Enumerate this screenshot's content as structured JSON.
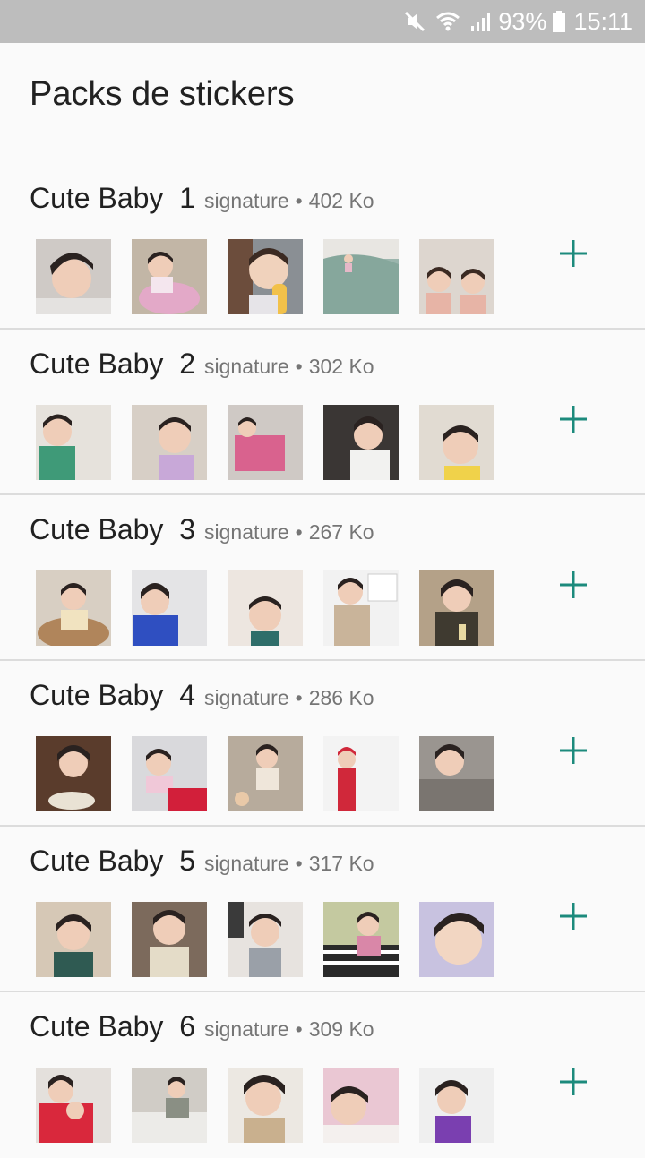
{
  "status_bar": {
    "battery": "93%",
    "time": "15:11",
    "icons": [
      "mute-icon",
      "wifi-icon",
      "signal-icon",
      "battery-icon"
    ],
    "color": "#bdbdbd"
  },
  "page": {
    "title": "Packs de stickers"
  },
  "accent_color": "#1c8a7c",
  "packs": [
    {
      "name": "Cute Baby  1",
      "author": "signature",
      "separator": "•",
      "size": "402 Ko"
    },
    {
      "name": "Cute Baby  2",
      "author": "signature",
      "separator": "•",
      "size": "302 Ko"
    },
    {
      "name": "Cute Baby  3",
      "author": "signature",
      "separator": "•",
      "size": "267 Ko"
    },
    {
      "name": "Cute Baby  4",
      "author": "signature",
      "separator": "•",
      "size": "286 Ko"
    },
    {
      "name": "Cute Baby  5",
      "author": "signature",
      "separator": "•",
      "size": "317 Ko"
    },
    {
      "name": "Cute Baby  6",
      "author": "signature",
      "separator": "•",
      "size": "309 Ko"
    }
  ]
}
